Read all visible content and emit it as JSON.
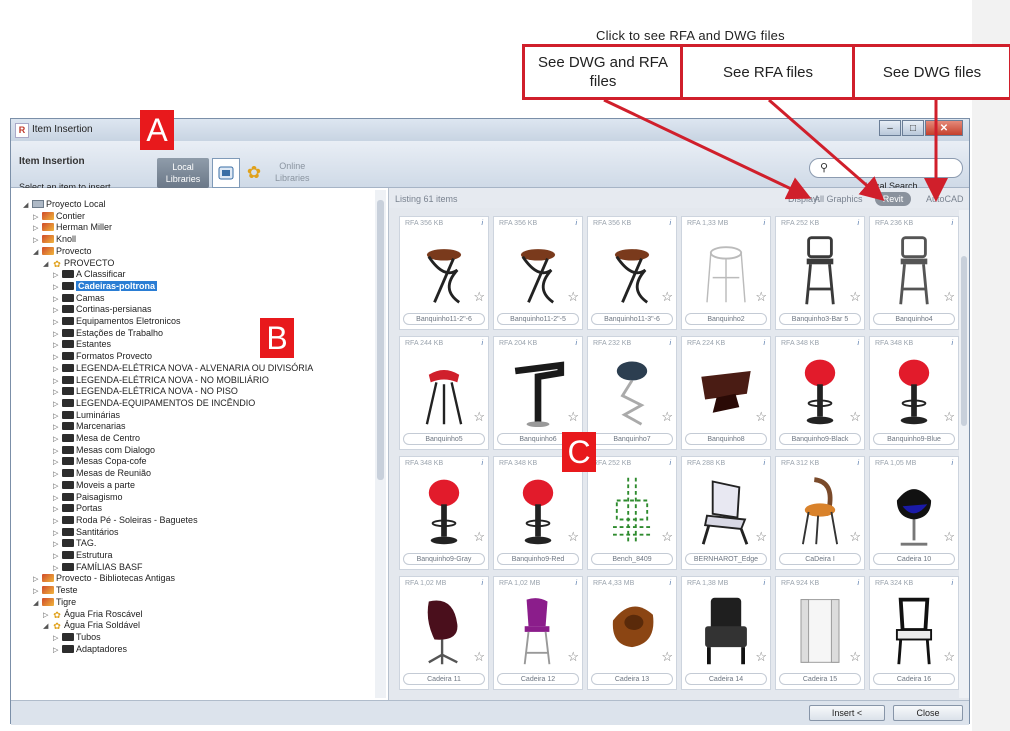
{
  "callouts": {
    "title": "Click to see RFA and DWG files",
    "boxes": [
      {
        "label": "See DWG and RFA files"
      },
      {
        "label": "See RFA files"
      },
      {
        "label": "See DWG files"
      }
    ],
    "markers": {
      "a": "A",
      "b": "B",
      "c": "C"
    },
    "accent_color": "#d01f2b"
  },
  "window": {
    "title": "Item Insertion",
    "buttons": {
      "minimize": "–",
      "maximize": "□",
      "close": "✕"
    }
  },
  "header": {
    "title": "Item Insertion",
    "subtitle": "Select an item to insert",
    "local_libraries": "Local Libraries",
    "online_libraries": "Online Libraries",
    "search_placeholder": "",
    "local_search": "Local Search"
  },
  "tree": [
    {
      "label": "Proyecto Local",
      "indent": 0,
      "toggle": "◢",
      "icon": "local"
    },
    {
      "label": "Contier",
      "indent": 1,
      "toggle": "▷",
      "icon": "lib"
    },
    {
      "label": "Herman Miller",
      "indent": 1,
      "toggle": "▷",
      "icon": "lib"
    },
    {
      "label": "Knoll",
      "indent": 1,
      "toggle": "▷",
      "icon": "lib"
    },
    {
      "label": "Provecto",
      "indent": 1,
      "toggle": "◢",
      "icon": "lib"
    },
    {
      "label": "PROVECTO",
      "indent": 2,
      "toggle": "◢",
      "icon": "tigre"
    },
    {
      "label": "A Classificar",
      "indent": 3,
      "toggle": "▷",
      "icon": "folder"
    },
    {
      "label": "Cadeiras-poltrona",
      "indent": 3,
      "toggle": "▷",
      "icon": "folder",
      "selected": true
    },
    {
      "label": "Camas",
      "indent": 3,
      "toggle": "▷",
      "icon": "folder"
    },
    {
      "label": "Cortinas-persianas",
      "indent": 3,
      "toggle": "▷",
      "icon": "folder"
    },
    {
      "label": "Equipamentos Eletronicos",
      "indent": 3,
      "toggle": "▷",
      "icon": "folder"
    },
    {
      "label": "Estações de Trabalho",
      "indent": 3,
      "toggle": "▷",
      "icon": "folder"
    },
    {
      "label": "Estantes",
      "indent": 3,
      "toggle": "▷",
      "icon": "folder"
    },
    {
      "label": "Formatos Provecto",
      "indent": 3,
      "toggle": "▷",
      "icon": "folder"
    },
    {
      "label": "LEGENDA-ELÉTRICA NOVA - ALVENARIA OU DIVISÓRIA",
      "indent": 3,
      "toggle": "▷",
      "icon": "folder"
    },
    {
      "label": "LEGENDA-ELÉTRICA NOVA - NO MOBILIÁRIO",
      "indent": 3,
      "toggle": "▷",
      "icon": "folder"
    },
    {
      "label": "LEGENDA-ELÉTRICA NOVA - NO PISO",
      "indent": 3,
      "toggle": "▷",
      "icon": "folder"
    },
    {
      "label": "LEGENDA-EQUIPAMENTOS DE INCÊNDIO",
      "indent": 3,
      "toggle": "▷",
      "icon": "folder"
    },
    {
      "label": "Luminárias",
      "indent": 3,
      "toggle": "▷",
      "icon": "folder"
    },
    {
      "label": "Marcenarias",
      "indent": 3,
      "toggle": "▷",
      "icon": "folder"
    },
    {
      "label": "Mesa de Centro",
      "indent": 3,
      "toggle": "▷",
      "icon": "folder"
    },
    {
      "label": "Mesas com Dialogo",
      "indent": 3,
      "toggle": "▷",
      "icon": "folder"
    },
    {
      "label": "Mesas Copa-cofe",
      "indent": 3,
      "toggle": "▷",
      "icon": "folder"
    },
    {
      "label": "Mesas de Reunião",
      "indent": 3,
      "toggle": "▷",
      "icon": "folder"
    },
    {
      "label": "Moveis a parte",
      "indent": 3,
      "toggle": "▷",
      "icon": "folder"
    },
    {
      "label": "Paisagismo",
      "indent": 3,
      "toggle": "▷",
      "icon": "folder"
    },
    {
      "label": "Portas",
      "indent": 3,
      "toggle": "▷",
      "icon": "folder"
    },
    {
      "label": "Roda Pé - Soleiras - Baguetes",
      "indent": 3,
      "toggle": "▷",
      "icon": "folder"
    },
    {
      "label": "Santitários",
      "indent": 3,
      "toggle": "▷",
      "icon": "folder"
    },
    {
      "label": "TAG.",
      "indent": 3,
      "toggle": "▷",
      "icon": "folder"
    },
    {
      "label": "Estrutura",
      "indent": 3,
      "toggle": "▷",
      "icon": "folder"
    },
    {
      "label": "FAMÍLIAS BASF",
      "indent": 3,
      "toggle": "▷",
      "icon": "folder"
    },
    {
      "label": "Provecto - Bibliotecas Antigas",
      "indent": 1,
      "toggle": "▷",
      "icon": "lib"
    },
    {
      "label": "Teste",
      "indent": 1,
      "toggle": "▷",
      "icon": "lib"
    },
    {
      "label": "Tigre",
      "indent": 1,
      "toggle": "◢",
      "icon": "lib"
    },
    {
      "label": "Água Fria Roscável",
      "indent": 2,
      "toggle": "▷",
      "icon": "tigre"
    },
    {
      "label": "Água Fria Soldável",
      "indent": 2,
      "toggle": "◢",
      "icon": "tigre"
    },
    {
      "label": "Tubos",
      "indent": 3,
      "toggle": "▷",
      "icon": "folder"
    },
    {
      "label": "Adaptadores",
      "indent": 3,
      "toggle": "▷",
      "icon": "folder"
    }
  ],
  "listing": {
    "count_text": "Listing 61 items",
    "display_label": "Display:",
    "options": {
      "all": "All Graphics",
      "revit": "Revit",
      "autocad": "AutoCAD"
    }
  },
  "items": [
    {
      "meta": "RFA 356 KB",
      "name": "Banquinho11-2\"-6",
      "kind": "spiral",
      "color": "#7a3a1c"
    },
    {
      "meta": "RFA 356 KB",
      "name": "Banquinho11-2\"-5",
      "kind": "spiral",
      "color": "#7a3a1c"
    },
    {
      "meta": "RFA 356 KB",
      "name": "Banquinho11-3\"-6",
      "kind": "spiral",
      "color": "#7a3a1c"
    },
    {
      "meta": "RFA 1,33 MB",
      "name": "Banquinho2",
      "kind": "wire",
      "color": "#bbbbbb"
    },
    {
      "meta": "RFA 252 KB",
      "name": "Banquinho3-Bar 5",
      "kind": "barstool",
      "color": "#3a3a3a"
    },
    {
      "meta": "RFA 236 KB",
      "name": "Banquinho4",
      "kind": "barstool",
      "color": "#555555"
    },
    {
      "meta": "RFA 244 KB",
      "name": "Banquinho5",
      "kind": "saddle",
      "color": "#d01f2b"
    },
    {
      "meta": "RFA 204 KB",
      "name": "Banquinho6",
      "kind": "zstool",
      "color": "#1a1a1a"
    },
    {
      "meta": "RFA 232 KB",
      "name": "Banquinho7",
      "kind": "round",
      "color": "#2c3e50"
    },
    {
      "meta": "RFA 224 KB",
      "name": "Banquinho8",
      "kind": "bench",
      "color": "#4a1c14"
    },
    {
      "meta": "RFA 348 KB",
      "name": "Banquinho9-Black",
      "kind": "pedestal",
      "color": "#e21b2b"
    },
    {
      "meta": "RFA 348 KB",
      "name": "Banquinho9-Blue",
      "kind": "pedestal",
      "color": "#e21b2b"
    },
    {
      "meta": "RFA 348 KB",
      "name": "Banquinho9-Gray",
      "kind": "pedestal",
      "color": "#e21b2b"
    },
    {
      "meta": "RFA 348 KB",
      "name": "Banquinho9-Red",
      "kind": "pedestal",
      "color": "#e21b2b"
    },
    {
      "meta": "RFA 252 KB",
      "name": "Bench_8409",
      "kind": "green",
      "color": "#2e8b2e"
    },
    {
      "meta": "RFA 288 KB",
      "name": "BERNHAROT_Edge",
      "kind": "lounge",
      "color": "#2b2b2b"
    },
    {
      "meta": "RFA 312 KB",
      "name": "CaDeira I",
      "kind": "cafe",
      "color": "#d9822b"
    },
    {
      "meta": "RFA 1,05 MB",
      "name": "Cadeira 10",
      "kind": "egg",
      "color": "#1a1aa8"
    },
    {
      "meta": "RFA 1,02 MB",
      "name": "Cadeira 11",
      "kind": "swivel",
      "color": "#4a0f1c"
    },
    {
      "meta": "RFA 1,02 MB",
      "name": "Cadeira 12",
      "kind": "highstool",
      "color": "#8b1d8b"
    },
    {
      "meta": "RFA 4,33 MB",
      "name": "Cadeira 13",
      "kind": "organic",
      "color": "#8b4513"
    },
    {
      "meta": "RFA 1,38 MB",
      "name": "Cadeira 14",
      "kind": "armchair",
      "color": "#1f1f1f"
    },
    {
      "meta": "RFA 924 KB",
      "name": "Cadeira 15",
      "kind": "box",
      "color": "#dddddd"
    },
    {
      "meta": "RFA 324 KB",
      "name": "Cadeira 16",
      "kind": "classic",
      "color": "#111111"
    }
  ],
  "footer": {
    "insert": "Insert <",
    "close": "Close"
  }
}
